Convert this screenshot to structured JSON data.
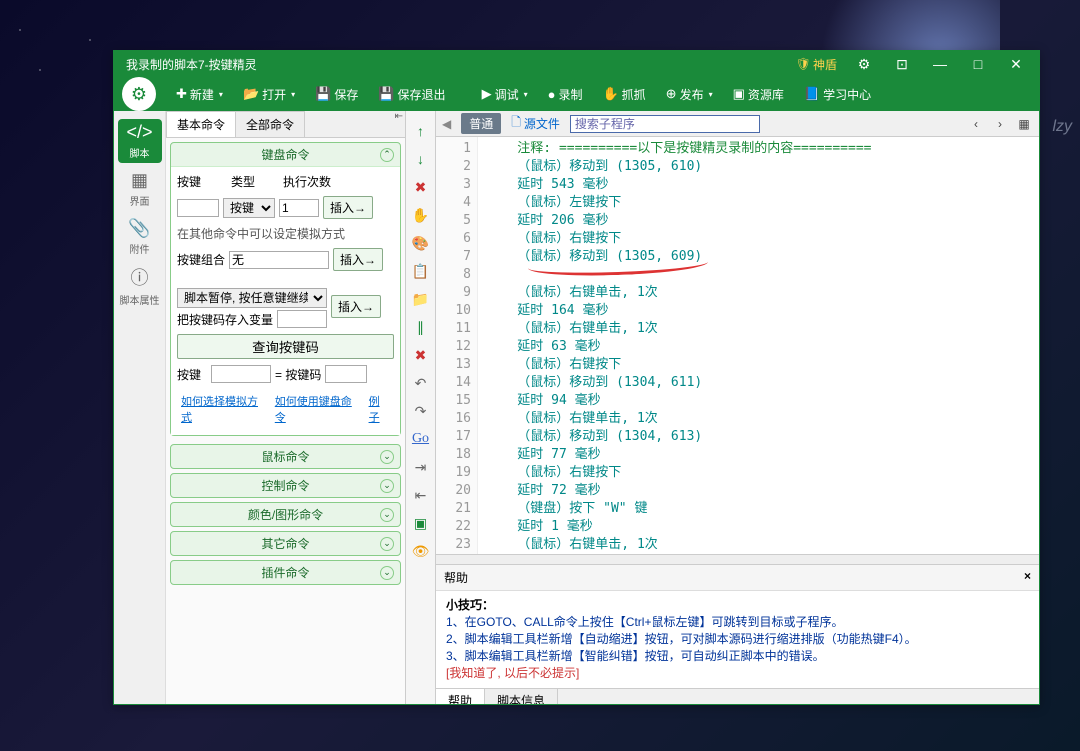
{
  "window": {
    "title": "我录制的脚本7-按键精灵",
    "shield_label": "神盾"
  },
  "toolbar": {
    "new": "新建",
    "open": "打开",
    "save": "保存",
    "save_exit": "保存退出",
    "debug": "调试",
    "record": "录制",
    "capture": "抓抓",
    "publish": "发布",
    "repo": "资源库",
    "learn": "学习中心"
  },
  "sidebar": {
    "items": [
      {
        "label": "脚本"
      },
      {
        "label": "界面"
      },
      {
        "label": "附件"
      },
      {
        "label": "脚本属性"
      }
    ]
  },
  "left": {
    "tab_basic": "基本命令",
    "tab_all": "全部命令",
    "keyboard_header": "键盘命令",
    "key_label": "按键",
    "type_label": "类型",
    "count_label": "执行次数",
    "type_value": "按键",
    "count_value": "1",
    "insert": "插入→",
    "sim_note": "在其他命令中可以设定模拟方式",
    "combo_label": "按键组合",
    "combo_value": "无",
    "pause_label": "脚本暂停, 按任意键继续",
    "savevar_label": "把按键码存入变量",
    "query_btn": "查询按键码",
    "key2_label": "按键",
    "eq_label": "= 按键码",
    "link_sim": "如何选择模拟方式",
    "link_kbd": "如何使用键盘命令",
    "link_ex": "例子",
    "sections": [
      "鼠标命令",
      "控制命令",
      "颜色/图形命令",
      "其它命令",
      "插件命令"
    ]
  },
  "mid_go": "Go",
  "editor": {
    "basic_tab": "普通",
    "src_tab": "源文件",
    "search_placeholder": "搜索子程序",
    "lines": [
      {
        "n": 1,
        "t": "注释: ==========以下是按键精灵录制的内容==========",
        "c": "comment"
      },
      {
        "n": 2,
        "t": "（鼠标）移动到 (1305, 610)"
      },
      {
        "n": 3,
        "t": "延时 543 毫秒"
      },
      {
        "n": 4,
        "t": "（鼠标）左键按下"
      },
      {
        "n": 5,
        "t": "延时 206 毫秒"
      },
      {
        "n": 6,
        "t": "（鼠标）右键按下"
      },
      {
        "n": 7,
        "t": "（鼠标）移动到 (1305, 609)"
      },
      {
        "n": 8,
        "t": ""
      },
      {
        "n": 9,
        "t": "（鼠标）右键单击, 1次"
      },
      {
        "n": 10,
        "t": "延时 164 毫秒"
      },
      {
        "n": 11,
        "t": "（鼠标）右键单击, 1次"
      },
      {
        "n": 12,
        "t": "延时 63 毫秒"
      },
      {
        "n": 13,
        "t": "（鼠标）右键按下"
      },
      {
        "n": 14,
        "t": "（鼠标）移动到 (1304, 611)"
      },
      {
        "n": 15,
        "t": "延时 94 毫秒"
      },
      {
        "n": 16,
        "t": "（鼠标）右键单击, 1次"
      },
      {
        "n": 17,
        "t": "（鼠标）移动到 (1304, 613)"
      },
      {
        "n": 18,
        "t": "延时 77 毫秒"
      },
      {
        "n": 19,
        "t": "（鼠标）右键按下"
      },
      {
        "n": 20,
        "t": "延时 72 毫秒"
      },
      {
        "n": 21,
        "t": "（键盘）按下 \"W\" 键"
      },
      {
        "n": 22,
        "t": "延时 1 毫秒"
      },
      {
        "n": 23,
        "t": "（鼠标）右键单击, 1次"
      }
    ]
  },
  "help": {
    "header": "帮助",
    "tip_title": "小技巧：",
    "tip1": "1、在GOTO、CALL命令上按住【Ctrl+鼠标左键】可跳转到目标或子程序。",
    "tip2": "2、脚本编辑工具栏新增【自动缩进】按钮，可对脚本源码进行缩进排版（功能热键F4）。",
    "tip3": "3、脚本编辑工具栏新增【智能纠错】按钮，可自动纠正脚本中的错误。",
    "dismiss": "[我知道了, 以后不必提示]",
    "tab_help": "帮助",
    "tab_info": "脚本信息"
  },
  "watermark": "lzy"
}
